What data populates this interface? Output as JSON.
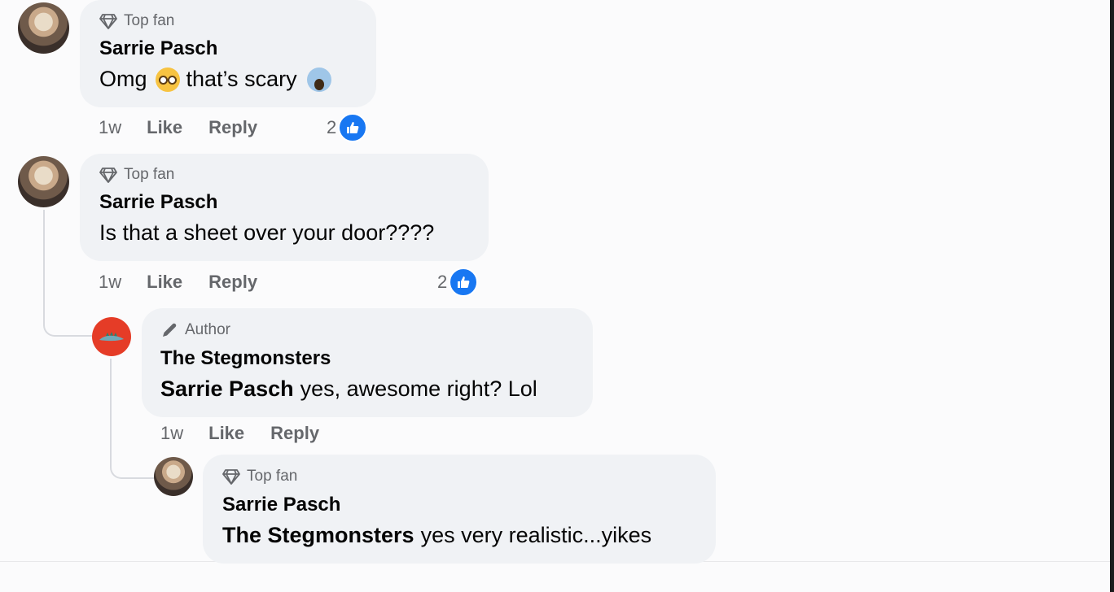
{
  "comments": [
    {
      "badge": "Top fan",
      "author": "Sarrie Pasch",
      "text_parts": [
        "Omg",
        "that’s scary"
      ],
      "time": "1w",
      "like_label": "Like",
      "reply_label": "Reply",
      "reaction_count": "2"
    },
    {
      "badge": "Top fan",
      "author": "Sarrie Pasch",
      "text": "Is that a sheet over your door????",
      "time": "1w",
      "like_label": "Like",
      "reply_label": "Reply",
      "reaction_count": "2"
    },
    {
      "badge": "Author",
      "author": "The Stegmonsters",
      "mention": "Sarrie Pasch",
      "text": "yes, awesome right? Lol",
      "time": "1w",
      "like_label": "Like",
      "reply_label": "Reply"
    },
    {
      "badge": "Top fan",
      "author": "Sarrie Pasch",
      "mention": "The Stegmonsters",
      "text": "yes very realistic...yikes"
    }
  ],
  "icons": {
    "top_fan": "diamond-icon",
    "author": "pencil-icon",
    "reaction": "thumbs-up-icon",
    "emoji_1": "flushed-face-emoji",
    "emoji_2": "screaming-face-emoji"
  },
  "colors": {
    "bubble": "#f0f2f5",
    "meta_text": "#65676b",
    "like_blue": "#1877f2",
    "author_avatar": "#e53c27"
  }
}
